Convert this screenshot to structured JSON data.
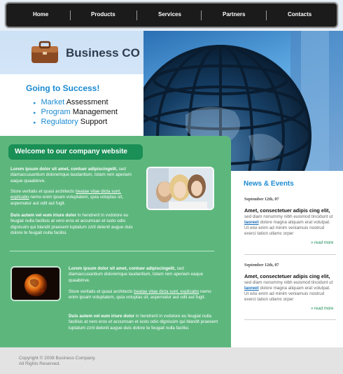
{
  "nav": {
    "items": [
      "Home",
      "Products",
      "Services",
      "Partners",
      "Contacts"
    ]
  },
  "header": {
    "brand": "Business CO",
    "tagline": "Going to Success!",
    "bullets": [
      {
        "highlight": "Market",
        "rest": " Assessment"
      },
      {
        "highlight": "Program",
        "rest": " Management"
      },
      {
        "highlight": "Regulatory",
        "rest": " Support"
      }
    ]
  },
  "welcome": {
    "title": "Welcome to our company website",
    "block1": {
      "lead": "Lorem ipsum dolor sit amet, contuer adipiscingelit,",
      "lead_rest": " sed diamaccusantium doloremque laudantium, totam rem aperiam eaque quaabinve.",
      "p2_start": "Store veritatis et quasi architecto ",
      "p2_link": "beatae vitae dicta sunt, explicabo",
      "p2_end": " nemo enim ipsam voluptatem, quia voluptas sit, aspernatur aut odit aut fugit.",
      "p3_lead": "Duis autem vel eum iriure dolor",
      "p3_rest": " in hendrerit in vvdolore eu feugiat nulla facilisis at vero eros et accumsan et iusto odio dignissim qui blandit praesent luptatum zzril delenit augue duis dolore te feugait nulla facilisi."
    },
    "block2": {
      "lead": "Lorem ipsum dolor sit amet, contuer adipiscingelit,",
      "lead_rest": " sed diamaccusantium doloremque laudantium, totam rem aperiam eaque quaabinve.",
      "p2_start": "Store veritatis et quasi architecto ",
      "p2_link": "beatae vitae dicta sunt, explicabo",
      "p2_end": " nemo enim ipsam voluptatem, quia voluptas sit, aspernatur aut odit aut fugit.",
      "p3_lead": "Duis autem vel eum iriure dolor",
      "p3_rest": " in hendrerit in vvdolore eu feugiat nulla facilisis at vero eros et accumsan et iusto odio dignissim qui blandit praesent luptatum zzril delenit augue duis dolore te feugait nulla facilisi."
    }
  },
  "news": {
    "title": "News & Events",
    "items": [
      {
        "date": "September 12th, 07",
        "headline": "Amet, consectetuer adipis cing elit,",
        "body_start": "sed diam nonummy nibh euismod tincidunt ut ",
        "body_link": "laoreet",
        "body_end": " dolore magna aliquam erat volutpat.  Ut wisi enim ad minim veniamuis nostrud exerci tation ullamc orper",
        "read_more": "read more"
      },
      {
        "date": "September 12th, 07",
        "headline": "Amet, consectetuer adipis cing elit,",
        "body_start": "sed diam nonummy nibh euismod tincidunt ut ",
        "body_link": "laoreet",
        "body_end": " dolore magna aliquam erat volutpat.  Ut wisi enim ad minim veniamuis nostrud exerci tation ullamc orper",
        "read_more": "read more"
      }
    ]
  },
  "footer": {
    "copyright": "Copyright © 2008 Business Company.",
    "rights": "All Rights Reserved."
  },
  "icons": {
    "logo": "briefcase-icon",
    "bullet": "arrow-right-icon",
    "read_more": "double-arrow-icon"
  },
  "colors": {
    "accent_blue": "#1a8ad1",
    "green_panel": "#5db77d",
    "green_dark": "#1a8f56",
    "nav_bg": "#1b1b1b"
  }
}
